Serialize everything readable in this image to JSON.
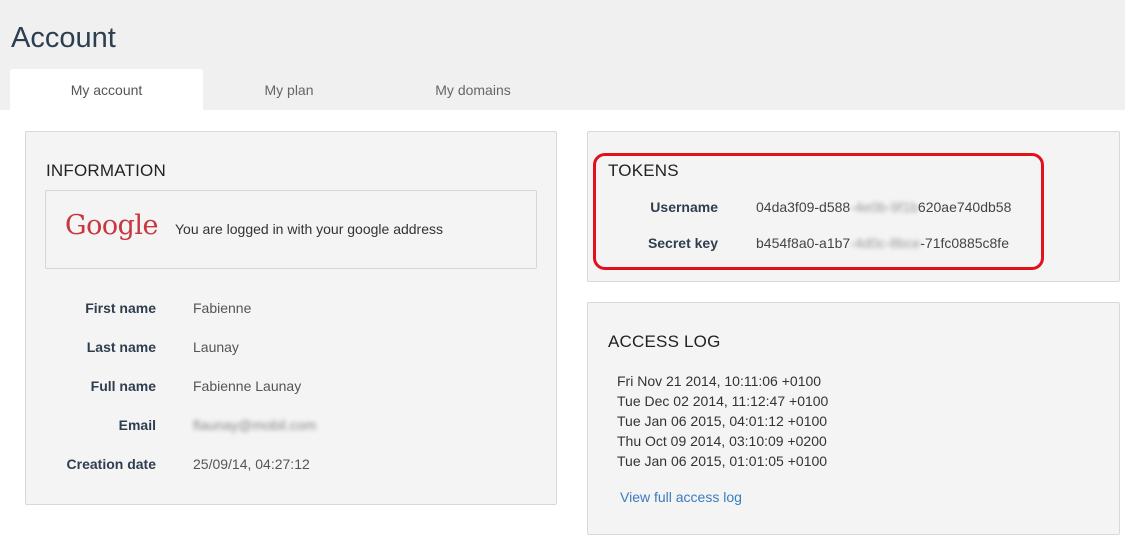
{
  "page": {
    "title": "Account"
  },
  "tabs": [
    {
      "label": "My account",
      "active": true
    },
    {
      "label": "My plan",
      "active": false
    },
    {
      "label": "My domains",
      "active": false
    }
  ],
  "information": {
    "title": "INFORMATION",
    "google": {
      "logo_text": "Google",
      "message": "You are logged in with your google address"
    },
    "fields": [
      {
        "label": "First name",
        "value": "Fabienne"
      },
      {
        "label": "Last name",
        "value": "Launay"
      },
      {
        "label": "Full name",
        "value": "Fabienne Launay"
      },
      {
        "label": "Email",
        "value": "flaunay@mobil.com",
        "blurred": true
      },
      {
        "label": "Creation date",
        "value": "25/09/14, 04:27:12"
      }
    ]
  },
  "tokens": {
    "title": "TOKENS",
    "items": [
      {
        "label": "Username",
        "prefix": "04da3f09-d588",
        "hidden": "-4e0b-9f1b",
        "suffix": "620ae740db58"
      },
      {
        "label": "Secret key",
        "prefix": "b454f8a0-a1b7",
        "hidden": "-4d0c-8bce",
        "suffix": "-71fc0885c8fe"
      }
    ],
    "highlight_color": "#e3101c"
  },
  "access_log": {
    "title": "ACCESS LOG",
    "entries": [
      "Fri Nov 21 2014, 10:11:06 +0100",
      "Tue Dec 02 2014, 11:12:47 +0100",
      "Tue Jan 06 2015, 04:01:12 +0100",
      "Thu Oct 09 2014, 03:10:09 +0200",
      "Tue Jan 06 2015, 01:01:05 +0100"
    ],
    "link_label": "View full access log"
  },
  "colors": {
    "header_bg": "#f0f0f0",
    "title": "#2c3e50",
    "link": "#3a7bbf",
    "google_red": "#c8363e"
  }
}
